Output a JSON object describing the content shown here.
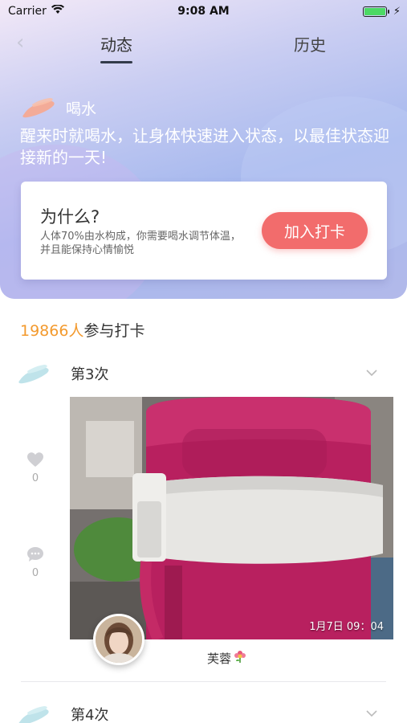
{
  "status_bar": {
    "carrier": "Carrier",
    "time": "9:08 AM"
  },
  "nav": {
    "tabs": [
      {
        "label": "动态",
        "active": true
      },
      {
        "label": "历史",
        "active": false
      }
    ]
  },
  "task": {
    "title": "喝水",
    "description": "醒来时就喝水，让身体快速进入状态，以最佳状态迎接新的一天!"
  },
  "why_card": {
    "title": "为什么?",
    "text": "人体70%由水构成，你需要喝水调节体温，并且能保持心情愉悦",
    "button_label": "加入打卡"
  },
  "participants": {
    "count": "19866人",
    "suffix": "参与打卡"
  },
  "feed": [
    {
      "label": "第3次",
      "likes": "0",
      "comments": "0",
      "photo_time": "1月7日 09：04",
      "username": "芙蓉",
      "username_icon": "flower-icon"
    },
    {
      "label": "第4次"
    }
  ],
  "colors": {
    "accent": "#f26c6c",
    "count_highlight": "#f39a2e",
    "header_gradient_start": "#f3e9f7",
    "header_gradient_end": "#a7b9ee"
  }
}
